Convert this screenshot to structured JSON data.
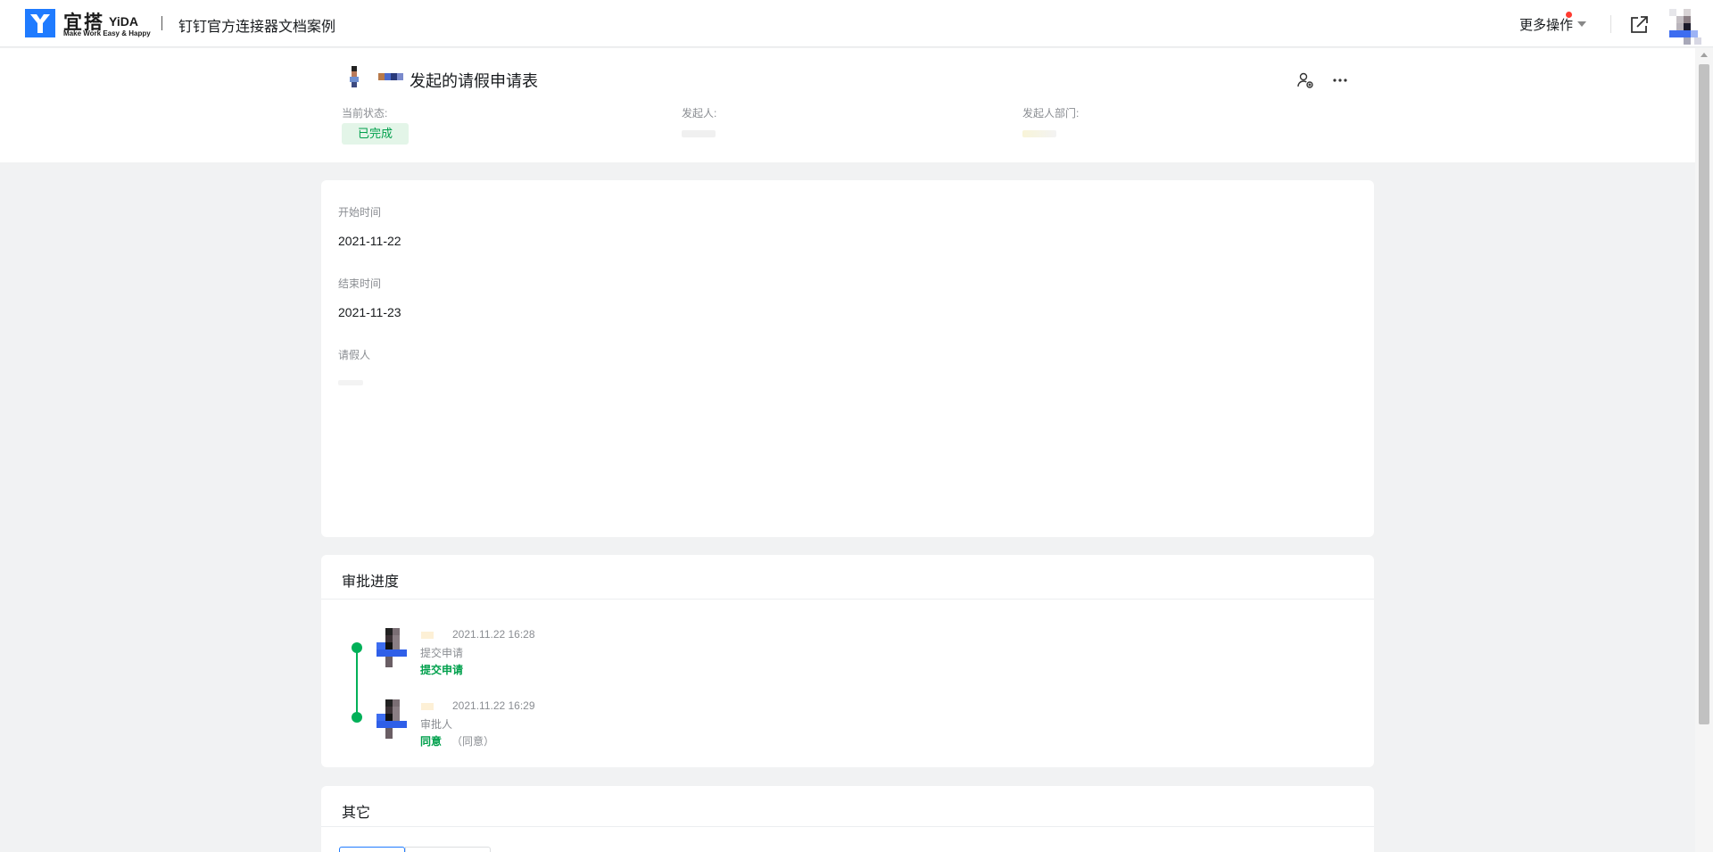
{
  "topbar": {
    "brand_cn": "宜搭",
    "brand_en": "YiDA",
    "brand_slogan": "Make Work Easy & Happy",
    "app_name": "钉钉官方连接器文档案例",
    "more_actions_label": "更多操作"
  },
  "header": {
    "form_title": "发起的请假申请表",
    "status_label": "当前状态:",
    "status_value": "已完成",
    "initiator_label": "发起人:",
    "department_label": "发起人部门:"
  },
  "fields": [
    {
      "label": "开始时间",
      "value": "2021-11-22"
    },
    {
      "label": "结束时间",
      "value": "2021-11-23"
    },
    {
      "label": "请假人",
      "value": ""
    }
  ],
  "approval": {
    "title": "审批进度",
    "steps": [
      {
        "time": "2021.11.22 16:28",
        "node": "提交申请",
        "action": "提交申请",
        "comment": ""
      },
      {
        "time": "2021.11.22 16:29",
        "node": "审批人",
        "action": "同意",
        "comment": "（同意）"
      }
    ]
  },
  "other": {
    "title": "其它"
  },
  "colors": {
    "accent_green": "#00a04c",
    "timeline_green": "#00b058",
    "brand_blue": "#1f7bff"
  }
}
